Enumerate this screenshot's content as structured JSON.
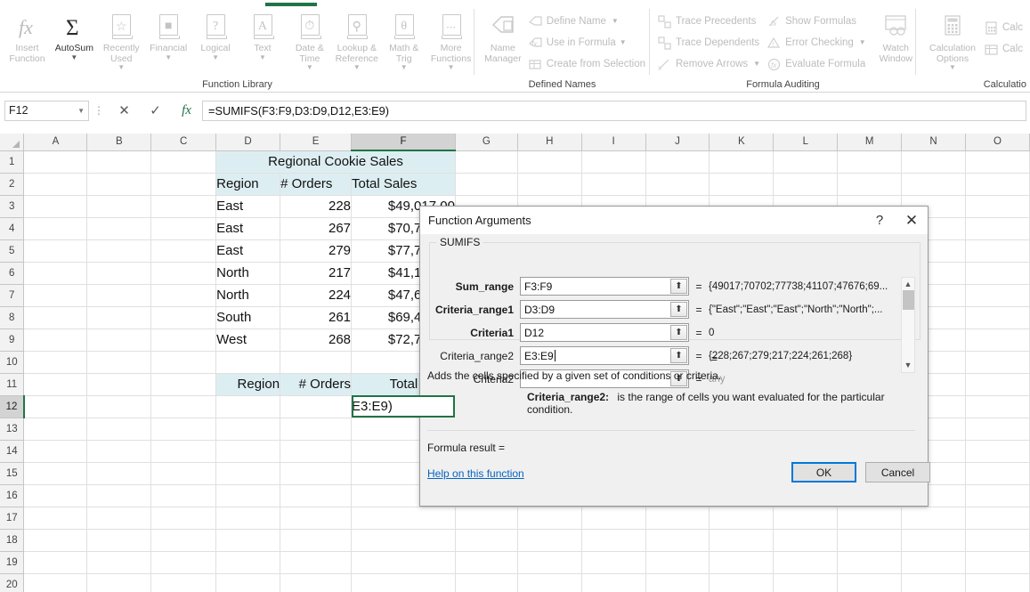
{
  "ribbon": {
    "active_tab_indicator": true,
    "groups": [
      {
        "name": "Function Library",
        "label": "Function Library",
        "big_buttons": [
          {
            "label": "Insert\nFunction",
            "icon": "fx-icon",
            "enabled": false,
            "caret": false
          },
          {
            "label": "AutoSum",
            "icon": "sigma-icon",
            "enabled": true,
            "caret": true
          },
          {
            "label": "Recently\nUsed",
            "icon": "star-book-icon",
            "enabled": false,
            "caret": true
          },
          {
            "label": "Financial",
            "icon": "coins-book-icon",
            "enabled": false,
            "caret": true
          },
          {
            "label": "Logical",
            "icon": "question-book-icon",
            "enabled": false,
            "caret": true
          },
          {
            "label": "Text",
            "icon": "letter-a-book-icon",
            "enabled": false,
            "caret": true
          },
          {
            "label": "Date &\nTime",
            "icon": "clock-book-icon",
            "enabled": false,
            "caret": true
          },
          {
            "label": "Lookup &\nReference",
            "icon": "magnifier-book-icon",
            "enabled": false,
            "caret": true
          },
          {
            "label": "Math &\nTrig",
            "icon": "theta-book-icon",
            "enabled": false,
            "caret": true
          },
          {
            "label": "More\nFunctions",
            "icon": "ellipsis-book-icon",
            "enabled": false,
            "caret": true
          }
        ]
      },
      {
        "name": "Defined Names",
        "label": "Defined Names",
        "big_buttons": [
          {
            "label": "Name\nManager",
            "icon": "name-tag-icon",
            "enabled": false,
            "caret": false
          }
        ],
        "small_buttons": [
          {
            "label": "Define Name",
            "icon": "define-name-icon",
            "caret": true
          },
          {
            "label": "Use in Formula",
            "icon": "use-in-formula-icon",
            "caret": true
          },
          {
            "label": "Create from Selection",
            "icon": "create-from-selection-icon",
            "caret": false
          }
        ]
      },
      {
        "name": "Formula Auditing",
        "label": "Formula Auditing",
        "small_buttons_col1": [
          {
            "label": "Trace Precedents",
            "icon": "trace-precedents-icon",
            "caret": false
          },
          {
            "label": "Trace Dependents",
            "icon": "trace-dependents-icon",
            "caret": false
          },
          {
            "label": "Remove Arrows",
            "icon": "remove-arrows-icon",
            "caret": true
          }
        ],
        "small_buttons_col2": [
          {
            "label": "Show Formulas",
            "icon": "show-formulas-icon",
            "caret": false
          },
          {
            "label": "Error Checking",
            "icon": "error-checking-icon",
            "caret": true
          },
          {
            "label": "Evaluate Formula",
            "icon": "evaluate-formula-icon",
            "caret": false
          }
        ],
        "watch_window": {
          "label": "Watch\nWindow",
          "icon": "watch-window-icon"
        }
      },
      {
        "name": "Calculation",
        "label": "Calculatio",
        "big_buttons": [
          {
            "label": "Calculation\nOptions",
            "icon": "calculation-options-icon",
            "enabled": false,
            "caret": true
          }
        ],
        "small_buttons": [
          {
            "label": "Calc",
            "icon": "calculate-now-icon",
            "caret": false
          },
          {
            "label": "Calc",
            "icon": "calculate-sheet-icon",
            "caret": false
          }
        ]
      }
    ]
  },
  "formula_bar": {
    "name_box_value": "F12",
    "cancel_icon": "cancel-x-icon",
    "enter_icon": "enter-check-icon",
    "fx_icon": "insert-function-fx-icon",
    "formula_value": "=SUMIFS(F3:F9,D3:D9,D12,E3:E9)"
  },
  "grid": {
    "columns": [
      "A",
      "B",
      "C",
      "D",
      "E",
      "F",
      "G",
      "H",
      "I",
      "J",
      "K",
      "L",
      "M",
      "N",
      "O"
    ],
    "selected_column": "F",
    "selected_row": "12",
    "rows": [
      "1",
      "2",
      "3",
      "4",
      "5",
      "6",
      "7",
      "8",
      "9",
      "10",
      "11",
      "12",
      "13",
      "14",
      "15",
      "16",
      "17",
      "18",
      "19",
      "20"
    ],
    "cells": {
      "D1": {
        "text": "Regional Cookie Sales",
        "span": 3,
        "align": "ctr",
        "fill": true
      },
      "D2": {
        "text": "Region",
        "fill": true
      },
      "E2": {
        "text": "# Orders",
        "fill": true
      },
      "F2": {
        "text": "Total Sales",
        "fill": true
      },
      "D3": {
        "text": "East"
      },
      "E3": {
        "text": "228",
        "align": "num"
      },
      "F3": {
        "text": "$49,017.00",
        "align": "num"
      },
      "D4": {
        "text": "East"
      },
      "E4": {
        "text": "267",
        "align": "num"
      },
      "F4": {
        "text": "$70,702.00",
        "align": "num"
      },
      "D5": {
        "text": "East"
      },
      "E5": {
        "text": "279",
        "align": "num"
      },
      "F5": {
        "text": "$77,738.00",
        "align": "num"
      },
      "D6": {
        "text": "North"
      },
      "E6": {
        "text": "217",
        "align": "num"
      },
      "F6": {
        "text": "$41,107.00",
        "align": "num"
      },
      "D7": {
        "text": "North"
      },
      "E7": {
        "text": "224",
        "align": "num"
      },
      "F7": {
        "text": "$47,676.00",
        "align": "num"
      },
      "D8": {
        "text": "South"
      },
      "E8": {
        "text": "261",
        "align": "num"
      },
      "F8": {
        "text": "$69,495.00",
        "align": "num"
      },
      "D9": {
        "text": "West"
      },
      "E9": {
        "text": "268",
        "align": "num"
      },
      "F9": {
        "text": "$72,706.00",
        "align": "num"
      },
      "D11": {
        "text": "Region",
        "align": "num",
        "fill": true
      },
      "E11": {
        "text": "# Orders",
        "align": "num",
        "fill": true
      },
      "F11": {
        "text": "Total Sales",
        "align": "num",
        "fill": true
      },
      "F12": {
        "text": "E3:E9)",
        "editing": true
      }
    }
  },
  "dialog": {
    "title": "Function Arguments",
    "help_icon": "help-question-icon",
    "close_icon": "close-x-icon",
    "function_name": "SUMIFS",
    "arguments": [
      {
        "label": "Sum_range",
        "bold": true,
        "value": "F3:F9",
        "result": "{49017;70702;77738;41107;47676;69...",
        "muted": false,
        "focused": false
      },
      {
        "label": "Criteria_range1",
        "bold": true,
        "value": "D3:D9",
        "result": "{\"East\";\"East\";\"East\";\"North\";\"North\";...",
        "muted": false,
        "focused": false
      },
      {
        "label": "Criteria1",
        "bold": true,
        "value": "D12",
        "result": "0",
        "muted": false,
        "focused": false
      },
      {
        "label": "Criteria_range2",
        "bold": false,
        "value": "E3:E9",
        "result": "{228;267;279;217;224;261;268}",
        "muted": false,
        "focused": true
      },
      {
        "label": "Criteria2",
        "bold": false,
        "value": "",
        "result": "any",
        "muted": true,
        "focused": false
      }
    ],
    "collapse_icon": "range-collapse-icon",
    "scroll_up_icon": "scroll-up-chevron-icon",
    "scroll_down_icon": "scroll-down-chevron-icon",
    "equals_sign": "=",
    "description": "Adds the cells specified by a given set of conditions or criteria.",
    "arg_help_name": "Criteria_range2:",
    "arg_help_text": "is the range of cells you want evaluated for the particular condition.",
    "formula_result_label": "Formula result =",
    "formula_result_value": "",
    "help_link": "Help on this function",
    "ok_label": "OK",
    "cancel_label": "Cancel"
  },
  "colors": {
    "excel_green": "#217346",
    "header_fill": "#ddeef2",
    "ok_border": "#0078d7",
    "link": "#0563c1"
  }
}
